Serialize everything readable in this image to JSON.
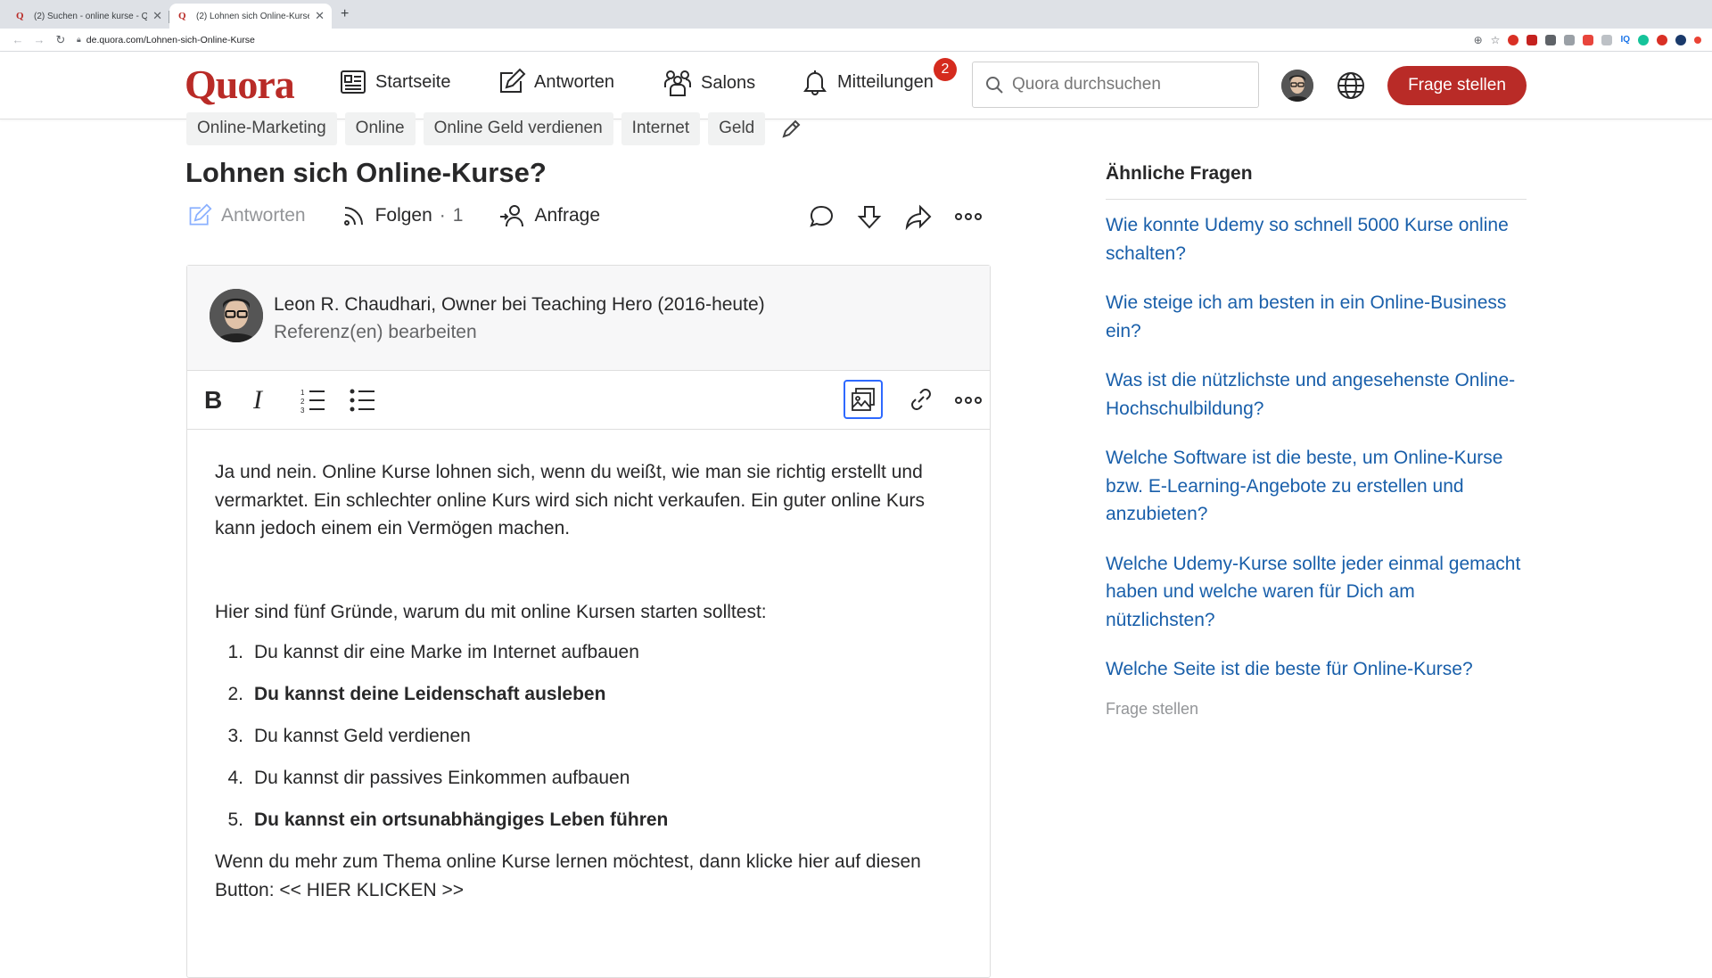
{
  "browser": {
    "tabs": [
      {
        "favicon": "Q",
        "title": "(2) Suchen - online kurse - Qu",
        "active": false
      },
      {
        "favicon": "Q",
        "title": "(2) Lohnen sich Online-Kurse?",
        "active": true
      }
    ],
    "url": "de.quora.com/Lohnen-sich-Online-Kurse"
  },
  "header": {
    "logo": "Quora",
    "nav": {
      "home": "Startseite",
      "answer": "Antworten",
      "spaces": "Salons",
      "notifications": "Mitteilungen",
      "notification_count": "2"
    },
    "search_placeholder": "Quora durchsuchen",
    "ask_button": "Frage stellen"
  },
  "question": {
    "topics": [
      "Online-Marketing",
      "Online",
      "Online Geld verdienen",
      "Internet",
      "Geld"
    ],
    "title": "Lohnen sich Online-Kurse?",
    "actions": {
      "answer": "Antworten",
      "follow": "Folgen",
      "follow_separator": "·",
      "follow_count": "1",
      "request": "Anfrage"
    }
  },
  "editor": {
    "author_credential": "Leon R. Chaudhari, Owner bei Teaching Hero (2016-heute)",
    "edit_credentials": "Referenz(en) bearbeiten",
    "paragraph1": "Ja und nein. Online Kurse lohnen sich, wenn du weißt, wie man sie richtig erstellt und vermarktet. Ein schlechter online Kurs wird sich nicht verkaufen. Ein guter online Kurs kann jedoch einem ein Vermögen machen.",
    "paragraph2": "Hier sind fünf Gründe, warum du mit online Kursen starten solltest:",
    "list": [
      {
        "num": "1.",
        "text": "Du kannst dir eine Marke im Internet aufbauen"
      },
      {
        "num": "2.",
        "text": "Du kannst deine Leidenschaft ausleben"
      },
      {
        "num": "3.",
        "text": "Du kannst Geld verdienen"
      },
      {
        "num": "4.",
        "text": "Du kannst dir passives Einkommen aufbauen"
      },
      {
        "num": "5.",
        "text": "Du kannst ein ortsunabhängiges Leben führen"
      }
    ],
    "paragraph3": "Wenn du mehr zum Thema online Kurse lernen möchtest, dann klicke hier auf diesen Button: << HIER KLICKEN >>"
  },
  "sidebar": {
    "title": "Ähnliche Fragen",
    "questions": [
      "Wie konnte Udemy so schnell 5000 Kurse online schalten?",
      "Wie steige ich am besten in ein Online-Business ein?",
      "Was ist die nützlichste und angesehenste Online-Hochschulbildung?",
      "Welche Software ist die beste, um Online-Kurse bzw. E-Learning-Angebote zu erstellen und anzubieten?",
      "Welche Udemy-Kurse sollte jeder einmal gemacht haben und welche waren für Dich am nützlichsten?",
      "Welche Seite ist die beste für Online-Kurse?"
    ],
    "ask": "Frage stellen"
  },
  "colors": {
    "brand": "#b92b27",
    "link": "#195faa",
    "badge": "#d52b1e",
    "focus": "#2e69ff"
  }
}
